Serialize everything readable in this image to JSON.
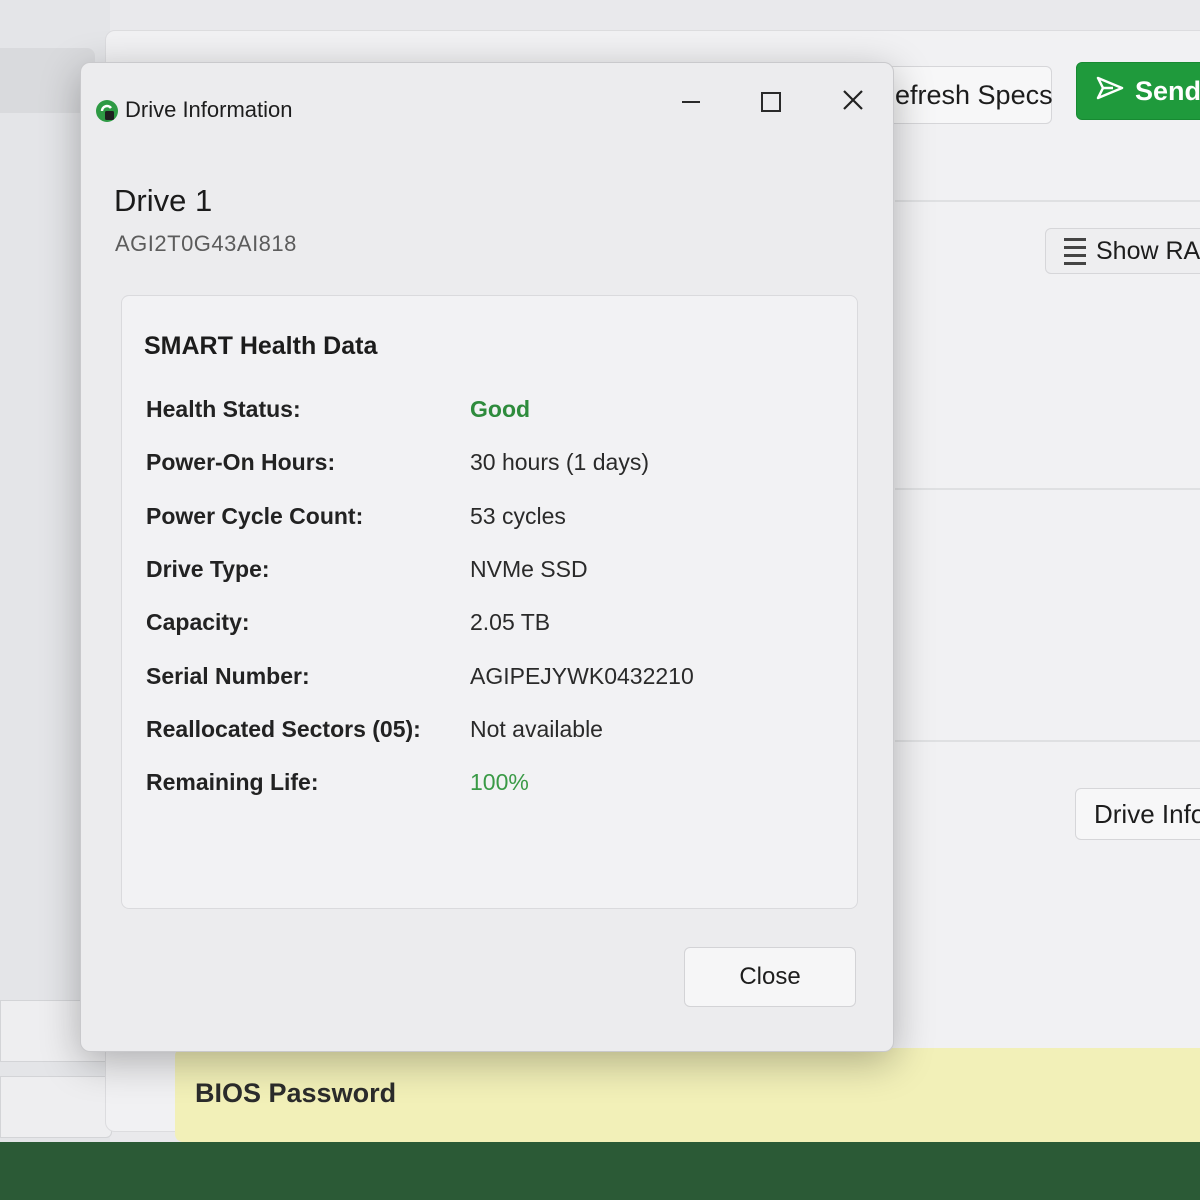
{
  "background": {
    "refresh_button": "efresh Specs",
    "send_button": "Send",
    "show_ram_button": "Show RAM",
    "drive_info_button": "Drive Info",
    "bios_password_label": "BIOS Password"
  },
  "dialog": {
    "title": "Drive Information",
    "drive_name": "Drive 1",
    "drive_model": "AGI2T0G43AI818",
    "smart": {
      "heading": "SMART Health Data",
      "rows": [
        {
          "label": "Health Status:",
          "value": "Good",
          "status": "good"
        },
        {
          "label": "Power-On Hours:",
          "value": "30 hours (1 days)"
        },
        {
          "label": "Power Cycle Count:",
          "value": "53 cycles"
        },
        {
          "label": "Drive Type:",
          "value": "NVMe SSD"
        },
        {
          "label": "Capacity:",
          "value": "2.05 TB"
        },
        {
          "label": "Serial Number:",
          "value": "AGIPEJYWK0432210"
        },
        {
          "label": "Reallocated Sectors (05):",
          "value": "Not available"
        },
        {
          "label": "Remaining Life:",
          "value": "100%",
          "status": "green"
        }
      ]
    },
    "close_button": "Close"
  },
  "colors": {
    "accent_green": "#1f9a3c",
    "good_text": "#2e8b3c",
    "bios_banner": "#f2f0b8"
  },
  "icons": [
    "app-icon",
    "minimize-icon",
    "maximize-icon",
    "close-icon",
    "send-icon",
    "list-icon"
  ]
}
